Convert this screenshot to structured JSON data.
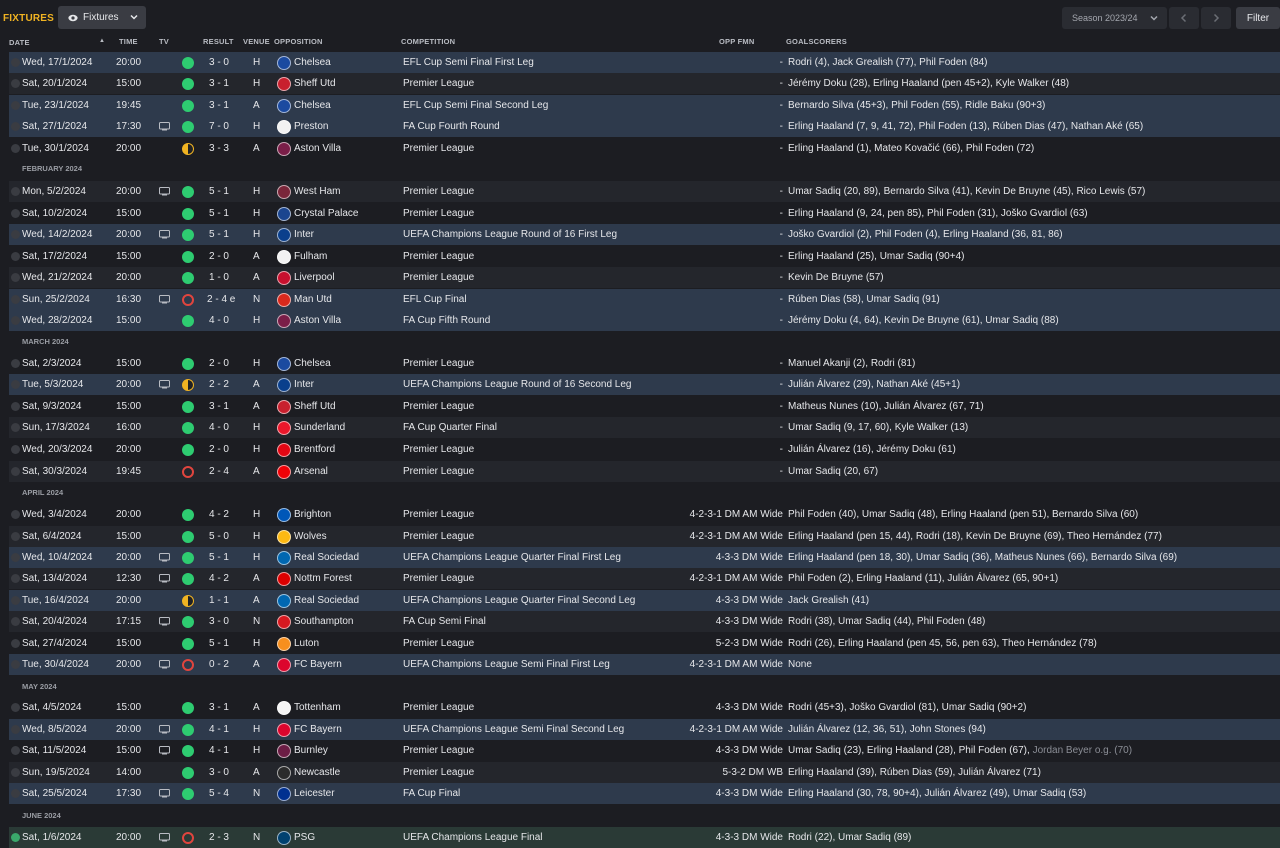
{
  "header": {
    "title": "FIXTURES",
    "view_label": "Fixtures",
    "season_label": "Season 2023/24",
    "filter_label": "Filter"
  },
  "columns": {
    "date": "DATE",
    "time": "TIME",
    "tv": "TV",
    "result": "RESULT",
    "venue": "VENUE",
    "opposition": "OPPOSITION",
    "competition": "COMPETITION",
    "opp_fmn": "OPP FMN",
    "goalscorers": "GOALSCORERS"
  },
  "colors": {
    "accent": "#f0b322",
    "win": "#2ecc71",
    "loss": "#e0453e",
    "row_highlight": "#2e3a4c"
  },
  "months": [
    "FEBRUARY 2024",
    "MARCH 2024",
    "APRIL 2024",
    "MAY 2024",
    "JUNE 2024"
  ],
  "fixtures": [
    {
      "date": "Wed, 17/1/2024",
      "time": "20:00",
      "tv": false,
      "result": "win",
      "score": "3 - 0",
      "venue": "H",
      "opp": "Chelsea",
      "crest": "#1b4aa0",
      "comp": "EFL Cup Semi Final First Leg",
      "fmn": "-",
      "goals": "Rodri (4), Jack Grealish (77), Phil Foden (84)",
      "og": ""
    },
    {
      "date": "Sat, 20/1/2024",
      "time": "15:00",
      "tv": false,
      "result": "win",
      "score": "3 - 1",
      "venue": "H",
      "opp": "Sheff Utd",
      "crest": "#c8202e",
      "comp": "Premier League",
      "fmn": "-",
      "goals": "Jérémy Doku (28), Erling Haaland (pen 45+2), Kyle Walker (48)",
      "og": ""
    },
    {
      "date": "Tue, 23/1/2024",
      "time": "19:45",
      "tv": false,
      "result": "win",
      "score": "3 - 1",
      "venue": "A",
      "opp": "Chelsea",
      "crest": "#1b4aa0",
      "comp": "EFL Cup Semi Final Second Leg",
      "fmn": "-",
      "goals": "Bernardo Silva (45+3), Phil Foden (55), Ridle Baku (90+3)",
      "og": ""
    },
    {
      "date": "Sat, 27/1/2024",
      "time": "17:30",
      "tv": true,
      "result": "win",
      "score": "7 - 0",
      "venue": "H",
      "opp": "Preston",
      "crest": "#f2f2f2",
      "comp": "FA Cup Fourth Round",
      "fmn": "-",
      "goals": "Erling Haaland (7, 9, 41, 72), Phil Foden (13), Rúben Dias (47), Nathan Aké (65)",
      "og": ""
    },
    {
      "date": "Tue, 30/1/2024",
      "time": "20:00",
      "tv": false,
      "result": "draw",
      "score": "3 - 3",
      "venue": "A",
      "opp": "Aston Villa",
      "crest": "#7a1e48",
      "comp": "Premier League",
      "fmn": "-",
      "goals": "Erling Haaland (1), Mateo Kovačić (66), Phil Foden (72)",
      "og": ""
    },
    {
      "date": "Mon, 5/2/2024",
      "time": "20:00",
      "tv": true,
      "result": "win",
      "score": "5 - 1",
      "venue": "H",
      "opp": "West Ham",
      "crest": "#7a263a",
      "comp": "Premier League",
      "fmn": "-",
      "goals": "Umar Sadiq (20, 89), Bernardo Silva (41), Kevin De Bruyne (45), Rico Lewis (57)",
      "og": ""
    },
    {
      "date": "Sat, 10/2/2024",
      "time": "15:00",
      "tv": false,
      "result": "win",
      "score": "5 - 1",
      "venue": "H",
      "opp": "Crystal Palace",
      "crest": "#1b458f",
      "comp": "Premier League",
      "fmn": "-",
      "goals": "Erling Haaland (9, 24, pen 85), Phil Foden (31), Joško Gvardiol (63)",
      "og": ""
    },
    {
      "date": "Wed, 14/2/2024",
      "time": "20:00",
      "tv": true,
      "result": "win",
      "score": "5 - 1",
      "venue": "H",
      "opp": "Inter",
      "crest": "#0a3f8c",
      "comp": "UEFA Champions League Round of 16 First Leg",
      "fmn": "-",
      "goals": "Joško Gvardiol (2), Phil Foden (4), Erling Haaland (36, 81, 86)",
      "og": ""
    },
    {
      "date": "Sat, 17/2/2024",
      "time": "15:00",
      "tv": false,
      "result": "win",
      "score": "2 - 0",
      "venue": "A",
      "opp": "Fulham",
      "crest": "#f2f2f2",
      "comp": "Premier League",
      "fmn": "-",
      "goals": "Erling Haaland (25), Umar Sadiq (90+4)",
      "og": ""
    },
    {
      "date": "Wed, 21/2/2024",
      "time": "20:00",
      "tv": false,
      "result": "win",
      "score": "1 - 0",
      "venue": "A",
      "opp": "Liverpool",
      "crest": "#c8102e",
      "comp": "Premier League",
      "fmn": "-",
      "goals": "Kevin De Bruyne (57)",
      "og": ""
    },
    {
      "date": "Sun, 25/2/2024",
      "time": "16:30",
      "tv": true,
      "result": "loss",
      "score": "2 - 4 e",
      "venue": "N",
      "opp": "Man Utd",
      "crest": "#da291c",
      "comp": "EFL Cup Final",
      "fmn": "-",
      "goals": "Rúben Dias (58), Umar Sadiq (91)",
      "og": ""
    },
    {
      "date": "Wed, 28/2/2024",
      "time": "15:00",
      "tv": false,
      "result": "win",
      "score": "4 - 0",
      "venue": "H",
      "opp": "Aston Villa",
      "crest": "#7a1e48",
      "comp": "FA Cup Fifth Round",
      "fmn": "-",
      "goals": "Jérémy Doku (4, 64), Kevin De Bruyne (61), Umar Sadiq (88)",
      "og": ""
    },
    {
      "date": "Sat, 2/3/2024",
      "time": "15:00",
      "tv": false,
      "result": "win",
      "score": "2 - 0",
      "venue": "H",
      "opp": "Chelsea",
      "crest": "#1b4aa0",
      "comp": "Premier League",
      "fmn": "-",
      "goals": "Manuel Akanji (2), Rodri (81)",
      "og": ""
    },
    {
      "date": "Tue, 5/3/2024",
      "time": "20:00",
      "tv": true,
      "result": "draw",
      "score": "2 - 2",
      "venue": "A",
      "opp": "Inter",
      "crest": "#0a3f8c",
      "comp": "UEFA Champions League Round of 16 Second Leg",
      "fmn": "-",
      "goals": "Julián Álvarez (29), Nathan Aké (45+1)",
      "og": ""
    },
    {
      "date": "Sat, 9/3/2024",
      "time": "15:00",
      "tv": false,
      "result": "win",
      "score": "3 - 1",
      "venue": "A",
      "opp": "Sheff Utd",
      "crest": "#c8202e",
      "comp": "Premier League",
      "fmn": "-",
      "goals": "Matheus Nunes (10), Julián Álvarez (67, 71)",
      "og": ""
    },
    {
      "date": "Sun, 17/3/2024",
      "time": "16:00",
      "tv": false,
      "result": "win",
      "score": "4 - 0",
      "venue": "H",
      "opp": "Sunderland",
      "crest": "#eb172b",
      "comp": "FA Cup Quarter Final",
      "fmn": "-",
      "goals": "Umar Sadiq (9, 17, 60), Kyle Walker (13)",
      "og": ""
    },
    {
      "date": "Wed, 20/3/2024",
      "time": "20:00",
      "tv": false,
      "result": "win",
      "score": "2 - 0",
      "venue": "H",
      "opp": "Brentford",
      "crest": "#e30613",
      "comp": "Premier League",
      "fmn": "-",
      "goals": "Julián Álvarez (16), Jérémy Doku (61)",
      "og": ""
    },
    {
      "date": "Sat, 30/3/2024",
      "time": "19:45",
      "tv": false,
      "result": "loss",
      "score": "2 - 4",
      "venue": "A",
      "opp": "Arsenal",
      "crest": "#ef0107",
      "comp": "Premier League",
      "fmn": "-",
      "goals": "Umar Sadiq (20, 67)",
      "og": ""
    },
    {
      "date": "Wed, 3/4/2024",
      "time": "20:00",
      "tv": false,
      "result": "win",
      "score": "4 - 2",
      "venue": "H",
      "opp": "Brighton",
      "crest": "#0057b8",
      "comp": "Premier League",
      "fmn": "4-2-3-1 DM AM Wide",
      "goals": "Phil Foden (40), Umar Sadiq (48), Erling Haaland (pen 51), Bernardo Silva (60)",
      "og": ""
    },
    {
      "date": "Sat, 6/4/2024",
      "time": "15:00",
      "tv": false,
      "result": "win",
      "score": "5 - 0",
      "venue": "H",
      "opp": "Wolves",
      "crest": "#fdb913",
      "comp": "Premier League",
      "fmn": "4-2-3-1 DM AM Wide",
      "goals": "Erling Haaland (pen 15, 44), Rodri (18), Kevin De Bruyne (69), Theo Hernández (77)",
      "og": ""
    },
    {
      "date": "Wed, 10/4/2024",
      "time": "20:00",
      "tv": true,
      "result": "win",
      "score": "5 - 1",
      "venue": "H",
      "opp": "Real Sociedad",
      "crest": "#0067b1",
      "comp": "UEFA Champions League Quarter Final First Leg",
      "fmn": "4-3-3 DM Wide",
      "goals": "Erling Haaland (pen 18, 30), Umar Sadiq (36), Matheus Nunes (66), Bernardo Silva (69)",
      "og": ""
    },
    {
      "date": "Sat, 13/4/2024",
      "time": "12:30",
      "tv": true,
      "result": "win",
      "score": "4 - 2",
      "venue": "A",
      "opp": "Nottm Forest",
      "crest": "#dd0000",
      "comp": "Premier League",
      "fmn": "4-2-3-1 DM AM Wide",
      "goals": "Phil Foden (2), Erling Haaland (11), Julián Álvarez (65, 90+1)",
      "og": ""
    },
    {
      "date": "Tue, 16/4/2024",
      "time": "20:00",
      "tv": false,
      "result": "draw",
      "score": "1 - 1",
      "venue": "A",
      "opp": "Real Sociedad",
      "crest": "#0067b1",
      "comp": "UEFA Champions League Quarter Final Second Leg",
      "fmn": "4-3-3 DM Wide",
      "goals": "Jack Grealish (41)",
      "og": ""
    },
    {
      "date": "Sat, 20/4/2024",
      "time": "17:15",
      "tv": true,
      "result": "win",
      "score": "3 - 0",
      "venue": "N",
      "opp": "Southampton",
      "crest": "#d71920",
      "comp": "FA Cup Semi Final",
      "fmn": "4-3-3 DM Wide",
      "goals": "Rodri (38), Umar Sadiq (44), Phil Foden (48)",
      "og": ""
    },
    {
      "date": "Sat, 27/4/2024",
      "time": "15:00",
      "tv": false,
      "result": "win",
      "score": "5 - 1",
      "venue": "H",
      "opp": "Luton",
      "crest": "#f78f1e",
      "comp": "Premier League",
      "fmn": "5-2-3 DM Wide",
      "goals": "Rodri (26), Erling Haaland (pen 45, 56, pen 63), Theo Hernández (78)",
      "og": ""
    },
    {
      "date": "Tue, 30/4/2024",
      "time": "20:00",
      "tv": true,
      "result": "loss",
      "score": "0 - 2",
      "venue": "A",
      "opp": "FC Bayern",
      "crest": "#dc052d",
      "comp": "UEFA Champions League Semi Final First Leg",
      "fmn": "4-2-3-1 DM AM Wide",
      "goals": "None",
      "og": ""
    },
    {
      "date": "Sat, 4/5/2024",
      "time": "15:00",
      "tv": false,
      "result": "win",
      "score": "3 - 1",
      "venue": "A",
      "opp": "Tottenham",
      "crest": "#f5f5f5",
      "comp": "Premier League",
      "fmn": "4-3-3 DM Wide",
      "goals": "Rodri (45+3), Joško Gvardiol (81), Umar Sadiq (90+2)",
      "og": ""
    },
    {
      "date": "Wed, 8/5/2024",
      "time": "20:00",
      "tv": true,
      "result": "win",
      "score": "4 - 1",
      "venue": "H",
      "opp": "FC Bayern",
      "crest": "#dc052d",
      "comp": "UEFA Champions League Semi Final Second Leg",
      "fmn": "4-2-3-1 DM AM Wide",
      "goals": "Julián Álvarez (12, 36, 51), John Stones (94)",
      "og": ""
    },
    {
      "date": "Sat, 11/5/2024",
      "time": "15:00",
      "tv": true,
      "result": "win",
      "score": "4 - 1",
      "venue": "H",
      "opp": "Burnley",
      "crest": "#6c1d45",
      "comp": "Premier League",
      "fmn": "4-3-3 DM Wide",
      "goals": "Umar Sadiq (23), Erling Haaland (28), Phil Foden (67),",
      "og": "Jordan Beyer o.g. (70)"
    },
    {
      "date": "Sun, 19/5/2024",
      "time": "14:00",
      "tv": false,
      "result": "win",
      "score": "3 - 0",
      "venue": "A",
      "opp": "Newcastle",
      "crest": "#2b2b2b",
      "comp": "Premier League",
      "fmn": "5-3-2 DM WB",
      "goals": "Erling Haaland (39), Rúben Dias (59), Julián Álvarez (71)",
      "og": ""
    },
    {
      "date": "Sat, 25/5/2024",
      "time": "17:30",
      "tv": true,
      "result": "win",
      "score": "5 - 4",
      "venue": "N",
      "opp": "Leicester",
      "crest": "#003090",
      "comp": "FA Cup Final",
      "fmn": "4-3-3 DM Wide",
      "goals": "Erling Haaland (30, 78, 90+4), Julián Álvarez (49), Umar Sadiq (53)",
      "og": ""
    },
    {
      "date": "Sat, 1/6/2024",
      "time": "20:00",
      "tv": true,
      "result": "loss",
      "score": "2 - 3",
      "venue": "N",
      "opp": "PSG",
      "crest": "#004170",
      "comp": "UEFA Champions League Final",
      "fmn": "4-3-3 DM Wide",
      "goals": "Rodri (22), Umar Sadiq (89)",
      "og": ""
    }
  ]
}
